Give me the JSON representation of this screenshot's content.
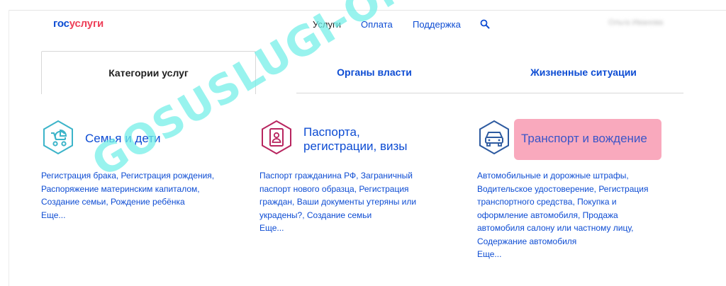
{
  "header": {
    "logo": {
      "part1": "гос",
      "part2": "услуги"
    },
    "nav": {
      "services": "Услуги",
      "payment": "Оплата",
      "support": "Поддержка"
    },
    "user_name": "Ольга Иванова"
  },
  "tabs": [
    {
      "label": "Категории услуг",
      "active": true
    },
    {
      "label": "Органы власти",
      "active": false
    },
    {
      "label": "Жизненные ситуации",
      "active": false
    }
  ],
  "categories": [
    {
      "icon": "stroller-icon",
      "title": "Семья и дети",
      "links": [
        "Регистрация брака, Регистрация рождения,",
        "Распоряжение материнским капиталом,",
        "Создание семьи, Рождение ребёнка",
        "Еще..."
      ]
    },
    {
      "icon": "passport-icon",
      "title_line1": "Паспорта,",
      "title_line2": "регистрации, визы",
      "links": [
        "Паспорт гражданина РФ, Заграничный",
        "паспорт нового образца, Регистрация",
        "граждан, Ваши документы утеряны или",
        "украдены?, Создание семьи",
        "Еще..."
      ]
    },
    {
      "icon": "car-icon",
      "title": "Транспорт и вождение",
      "highlight_color": "#f9a9bd",
      "links": [
        "Автомобильные и дорожные штрафы,",
        "Водительское удостоверение, Регистрация",
        "транспортного средства, Покупка и",
        "оформление автомобиля, Продажа",
        "автомобиля салону или частному лицу,",
        "Содержание автомобиля",
        "Еще..."
      ]
    }
  ],
  "watermark": "GOSUSLUGI-ONLINE.RU",
  "colors": {
    "brand_blue": "#0d4cd3",
    "brand_red": "#ee3f58",
    "icon_teal": "#3cb4c9",
    "icon_crimson": "#b8255f",
    "icon_navy": "#2d5aa0"
  }
}
